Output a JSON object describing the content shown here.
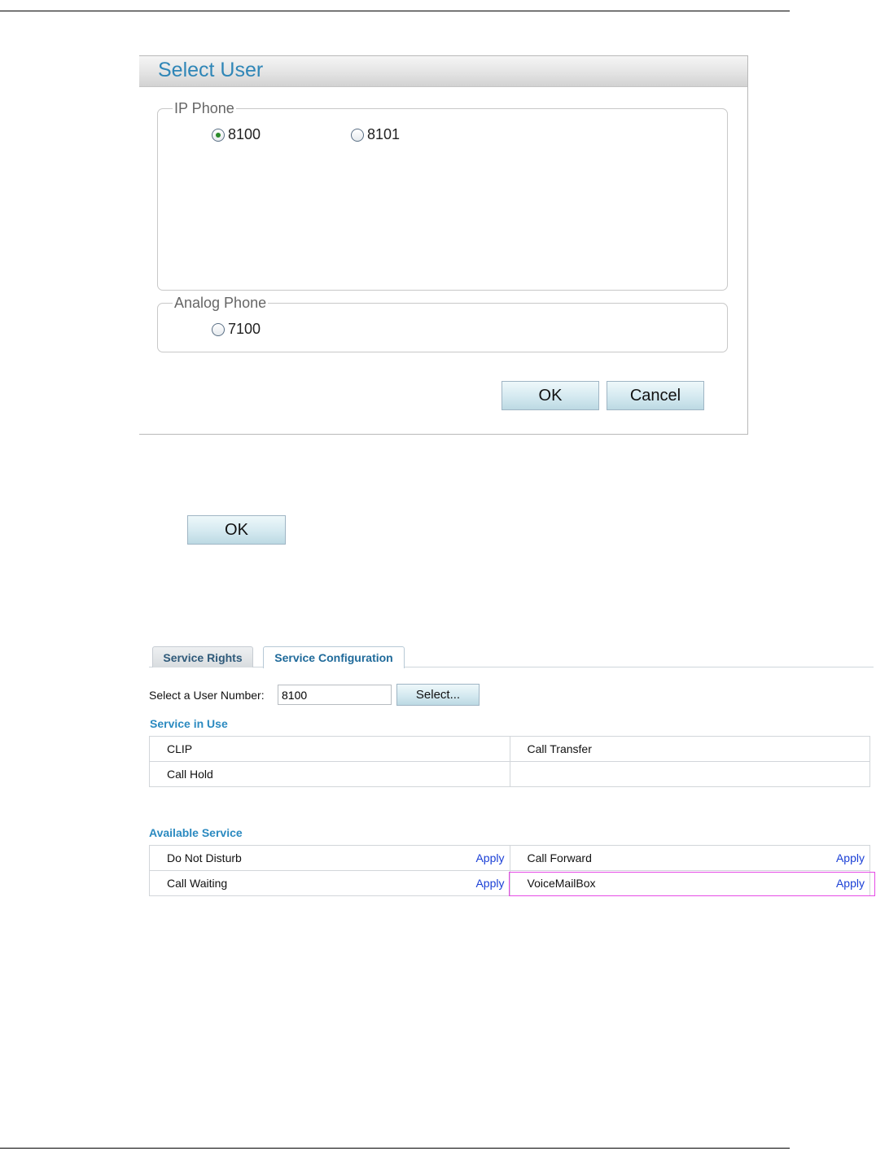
{
  "dialog": {
    "title": "Select User",
    "ip_group": {
      "legend": "IP Phone",
      "options": [
        "8100",
        "8101"
      ],
      "selected": "8100"
    },
    "analog_group": {
      "legend": "Analog Phone",
      "options": [
        "7100"
      ]
    },
    "ok_label": "OK",
    "cancel_label": "Cancel"
  },
  "standalone_ok_label": "OK",
  "panel": {
    "tabs": [
      "Service Rights",
      "Service Configuration"
    ],
    "active_tab": "Service Configuration",
    "user_label": "Select a User Number:",
    "user_value": "8100",
    "select_button": "Select...",
    "service_in_use": {
      "title": "Service in Use",
      "rows": [
        [
          "CLIP",
          "Call Transfer"
        ],
        [
          "Call Hold",
          ""
        ]
      ]
    },
    "available_service": {
      "title": "Available Service",
      "apply_label": "Apply",
      "rows": [
        [
          "Do Not Disturb",
          "Call Forward"
        ],
        [
          "Call Waiting",
          "VoiceMailBox"
        ]
      ],
      "highlighted": "VoiceMailBox",
      "highlight_color": "#e64ce6"
    }
  },
  "colors": {
    "accent": "#2f86b7",
    "link": "#1a3fd6"
  }
}
